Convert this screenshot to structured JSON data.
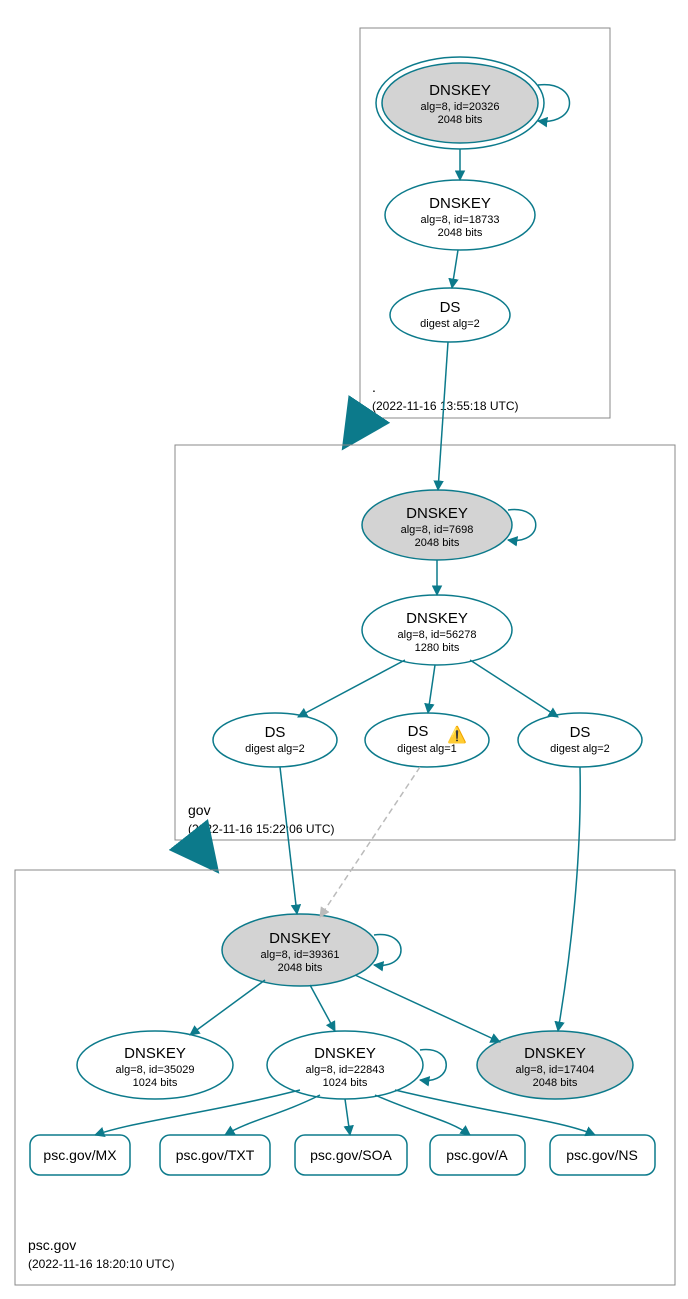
{
  "zones": {
    "root": {
      "name": ".",
      "timestamp": "(2022-11-16 13:55:18 UTC)"
    },
    "gov": {
      "name": "gov",
      "timestamp": "(2022-11-16 15:22:06 UTC)"
    },
    "psc": {
      "name": "psc.gov",
      "timestamp": "(2022-11-16 18:20:10 UTC)"
    }
  },
  "nodes": {
    "root_ksk": {
      "title": "DNSKEY",
      "line2": "alg=8, id=20326",
      "line3": "2048 bits"
    },
    "root_zsk": {
      "title": "DNSKEY",
      "line2": "alg=8, id=18733",
      "line3": "2048 bits"
    },
    "root_ds": {
      "title": "DS",
      "line2": "digest alg=2"
    },
    "gov_ksk": {
      "title": "DNSKEY",
      "line2": "alg=8, id=7698",
      "line3": "2048 bits"
    },
    "gov_zsk": {
      "title": "DNSKEY",
      "line2": "alg=8, id=56278",
      "line3": "1280 bits"
    },
    "gov_ds1": {
      "title": "DS",
      "line2": "digest alg=2"
    },
    "gov_ds2": {
      "title": "DS",
      "line2": "digest alg=1",
      "warn": true
    },
    "gov_ds3": {
      "title": "DS",
      "line2": "digest alg=2"
    },
    "psc_ksk": {
      "title": "DNSKEY",
      "line2": "alg=8, id=39361",
      "line3": "2048 bits"
    },
    "psc_k1": {
      "title": "DNSKEY",
      "line2": "alg=8, id=35029",
      "line3": "1024 bits"
    },
    "psc_k2": {
      "title": "DNSKEY",
      "line2": "alg=8, id=22843",
      "line3": "1024 bits"
    },
    "psc_k3": {
      "title": "DNSKEY",
      "line2": "alg=8, id=17404",
      "line3": "2048 bits"
    },
    "rr_mx": {
      "label": "psc.gov/MX"
    },
    "rr_txt": {
      "label": "psc.gov/TXT"
    },
    "rr_soa": {
      "label": "psc.gov/SOA"
    },
    "rr_a": {
      "label": "psc.gov/A"
    },
    "rr_ns": {
      "label": "psc.gov/NS"
    }
  },
  "colors": {
    "edge": "#0c7a8b",
    "grey_fill": "#d3d3d3"
  }
}
